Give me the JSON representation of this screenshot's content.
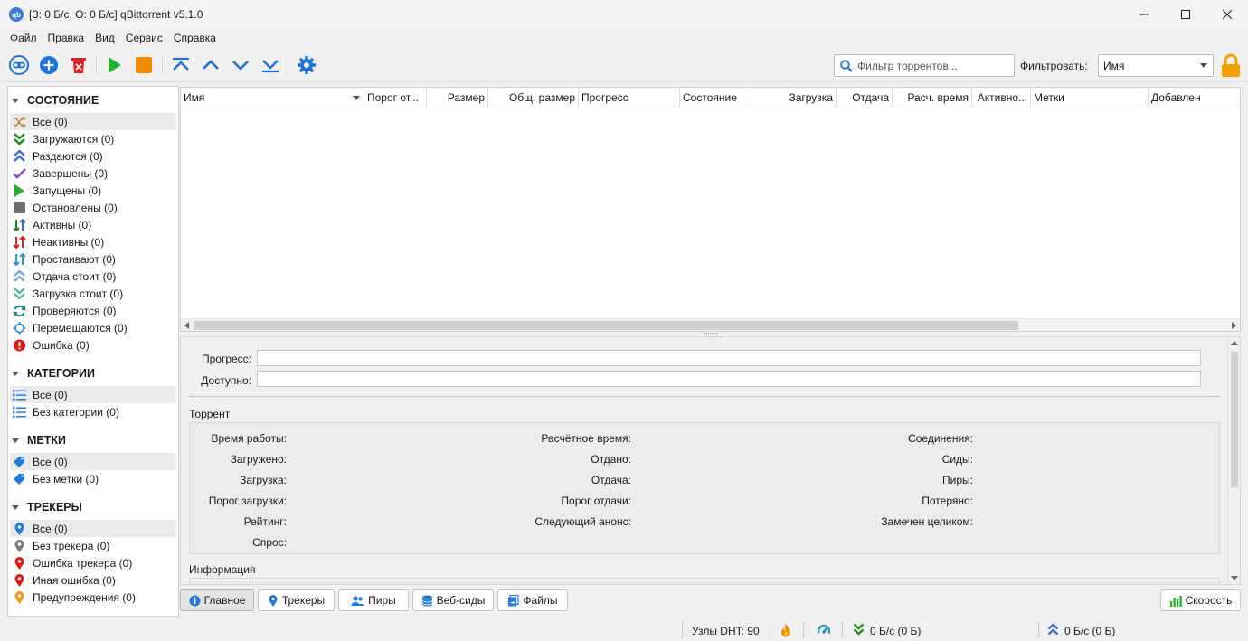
{
  "window": {
    "title": "[З: 0 Б/с, О: 0 Б/с] qBittorrent v5.1.0",
    "app_icon_text": "qb"
  },
  "menu": [
    "Файл",
    "Правка",
    "Вид",
    "Сервис",
    "Справка"
  ],
  "toolbar": {
    "search_placeholder": "Фильтр торрентов...",
    "filter_label": "Фильтровать:",
    "filter_value": "Имя"
  },
  "sidebar": {
    "status": {
      "header": "СОСТОЯНИЕ",
      "items": [
        "Все (0)",
        "Загружаются (0)",
        "Раздаются (0)",
        "Завершены (0)",
        "Запущены (0)",
        "Остановлены (0)",
        "Активны (0)",
        "Неактивны (0)",
        "Простаивают (0)",
        "Отдача стоит (0)",
        "Загрузка стоит (0)",
        "Проверяются (0)",
        "Перемещаются (0)",
        "Ошибка (0)"
      ]
    },
    "categories": {
      "header": "КАТЕГОРИИ",
      "items": [
        "Все (0)",
        "Без категории (0)"
      ]
    },
    "tags": {
      "header": "МЕТКИ",
      "items": [
        "Все (0)",
        "Без метки (0)"
      ]
    },
    "trackers": {
      "header": "ТРЕКЕРЫ",
      "items": [
        "Все (0)",
        "Без трекера (0)",
        "Ошибка трекера (0)",
        "Иная ошибка (0)",
        "Предупреждения (0)"
      ]
    }
  },
  "columns": [
    "Имя",
    "Порог от...",
    "Размер",
    "Общ. размер",
    "Прогресс",
    "Состояние",
    "Загрузка",
    "Отдача",
    "Расч. время",
    "Активно...",
    "Метки",
    "Добавлен"
  ],
  "props": {
    "progress_label": "Прогресс:",
    "available_label": "Доступно:",
    "torrent_group": "Торрент",
    "col1": [
      "Время работы:",
      "Загружено:",
      "Загрузка:",
      "Порог загрузки:",
      "Рейтинг:",
      "Спрос:"
    ],
    "col2": [
      "Расчётное время:",
      "Отдано:",
      "Отдача:",
      "Порог отдачи:",
      "Следующий анонс:"
    ],
    "col3": [
      "Соединения:",
      "Сиды:",
      "Пиры:",
      "Потеряно:",
      "Замечен целиком:"
    ],
    "info_group": "Информация"
  },
  "tabs": [
    "Главное",
    "Трекеры",
    "Пиры",
    "Веб-сиды",
    "Файлы"
  ],
  "speed_button": "Скорость",
  "statusbar": {
    "dht": "Узлы DHT: 90",
    "download": "0 Б/с (0 Б)",
    "upload": "0 Б/с (0 Б)"
  }
}
